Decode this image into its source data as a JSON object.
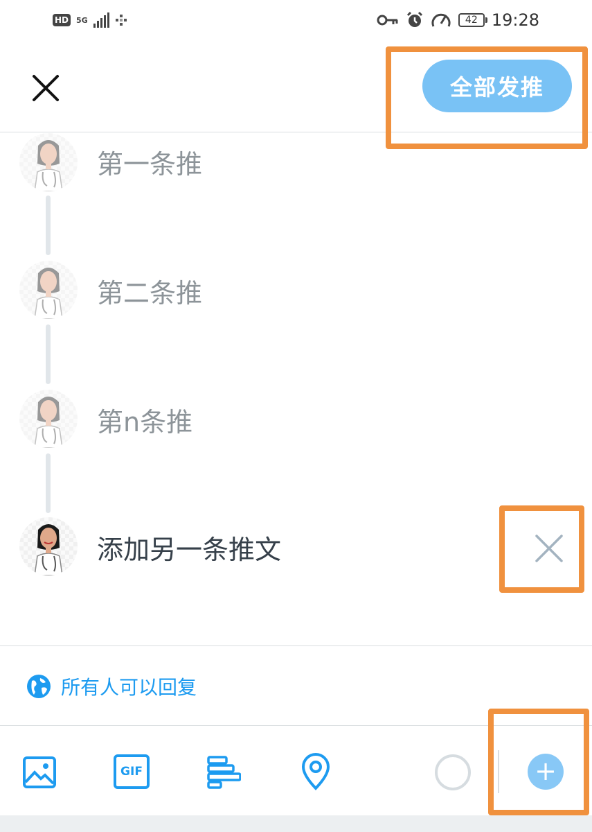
{
  "status_bar": {
    "hd": "HD",
    "network": "5G",
    "time": "19:28",
    "battery": "42",
    "icons": [
      "hd-icon",
      "signal-icon",
      "data-icon",
      "vpn-key-icon",
      "alarm-icon",
      "speed-icon",
      "battery-icon"
    ]
  },
  "header": {
    "close_icon": "close-icon",
    "tweet_all_label": "全部发推"
  },
  "thread": {
    "tweets": [
      {
        "text": "第一条推"
      },
      {
        "text": "第二条推"
      },
      {
        "text": "第n条推"
      }
    ],
    "composer": {
      "text": "添加另一条推文",
      "remove_icon": "close-icon"
    }
  },
  "reply_setting": {
    "icon": "globe-icon",
    "label": "所有人可以回复"
  },
  "toolbar": {
    "icons": [
      "image-icon",
      "gif-icon",
      "poll-icon",
      "location-icon",
      "character-counter",
      "add-tweet-icon"
    ],
    "gif_label": "GIF",
    "add_label": "+"
  },
  "colors": {
    "accent": "#1d9bf0",
    "button_disabled": "#79c2f5",
    "highlight": "#f0913e",
    "muted_text": "#8d9499"
  }
}
